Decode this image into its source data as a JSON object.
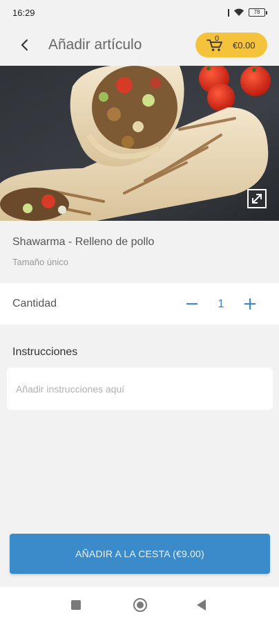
{
  "status_bar": {
    "time": "16:29",
    "battery": "78"
  },
  "header": {
    "title": "Añadir artículo",
    "cart_count": "0",
    "cart_total": "€0.00"
  },
  "product": {
    "name": "Shawarma - Relleno de pollo",
    "size": "Tamaño único"
  },
  "quantity": {
    "label": "Cantidad",
    "value": "1"
  },
  "instructions": {
    "title": "Instrucciones",
    "placeholder": "Añadir instrucciones aquí",
    "value": ""
  },
  "add_button": {
    "label": "AÑADIR A LA CESTA (€9.00)"
  },
  "colors": {
    "accent_yellow": "#f5c33b",
    "primary_blue": "#3b8ac9",
    "qty_blue": "#3b86c6",
    "background": "#f2f2f3"
  },
  "icons": {
    "back": "chevron-left-icon",
    "cart": "shopping-cart-icon",
    "expand": "expand-icon",
    "minus": "minus-icon",
    "plus": "plus-icon"
  }
}
